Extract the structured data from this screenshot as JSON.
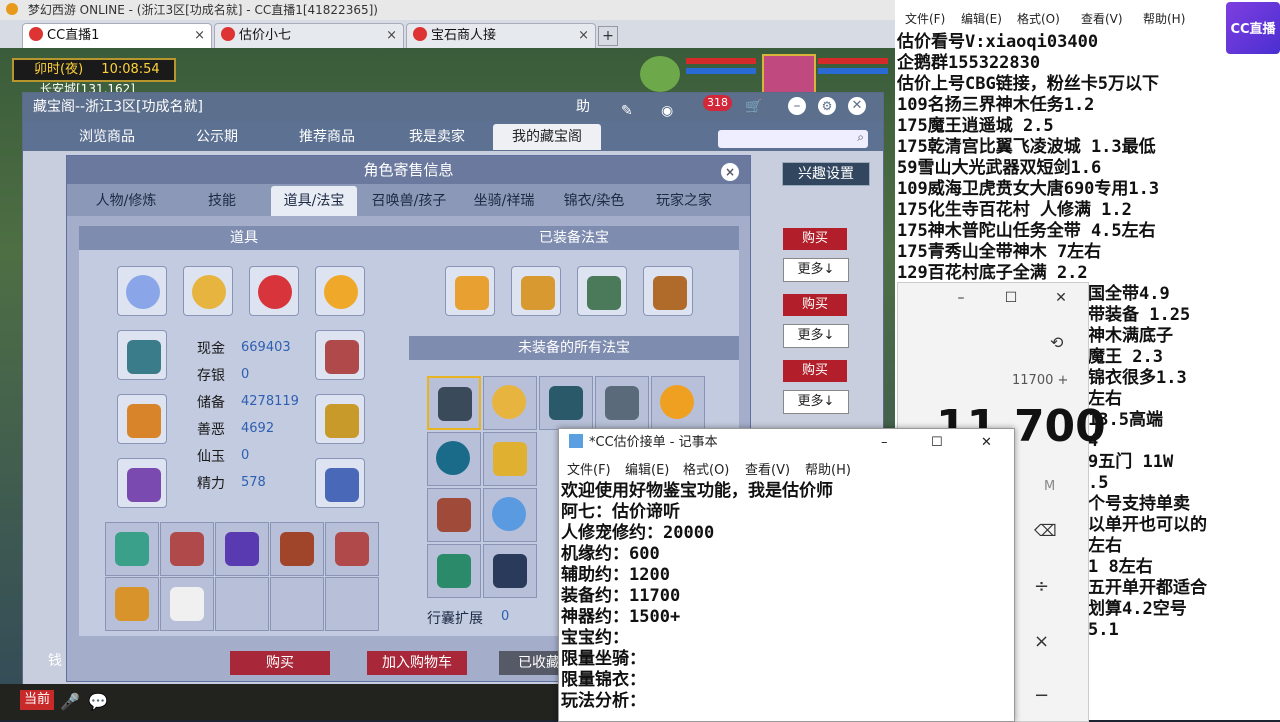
{
  "browser": {
    "title": "梦幻西游 ONLINE - (浙江3区[功成名就] - CC直播1[41822365])",
    "tabs": [
      {
        "label": "CC直播1",
        "active": true
      },
      {
        "label": "估价小七",
        "active": false
      },
      {
        "label": "宝石商人接",
        "active": false
      }
    ],
    "new_tab": "+"
  },
  "game": {
    "clock_label": "卯时(夜)",
    "clock_time": "10:08:54",
    "coords": "长安城[131,162]",
    "bottom_left": "当前",
    "bottom_money": "钱"
  },
  "cbg": {
    "title": "藏宝阁--浙江3区[功成名就]",
    "help": "助",
    "cart_count": "318",
    "nav": [
      "浏览商品",
      "公示期",
      "推荐商品",
      "我是卖家",
      "我的藏宝阁"
    ],
    "interest_btn": "兴趣设置",
    "side_buttons": [
      {
        "buy": "购买",
        "more": "更多↓"
      },
      {
        "buy": "购买",
        "more": "更多↓"
      },
      {
        "buy": "购买",
        "more": "更多↓"
      }
    ]
  },
  "dialog": {
    "title": "角色寄售信息",
    "close": "×",
    "tabs": [
      "人物/修炼",
      "技能",
      "道具/法宝",
      "召唤兽/孩子",
      "坐骑/祥瑞",
      "锦衣/染色",
      "玩家之家"
    ],
    "left_header": "道具",
    "right_header": "已装备法宝",
    "unequipped_header": "未装备的所有法宝",
    "stats": [
      {
        "label": "现金",
        "value": "669403"
      },
      {
        "label": "存银",
        "value": "0"
      },
      {
        "label": "储备",
        "value": "4278119"
      },
      {
        "label": "善恶",
        "value": "4692"
      },
      {
        "label": "仙玉",
        "value": "0"
      },
      {
        "label": "精力",
        "value": "578"
      }
    ],
    "bag_expand_label": "行囊扩展",
    "bag_expand_value": "0",
    "buttons": {
      "buy": "购买",
      "add_cart": "加入购物车",
      "collected": "已收藏"
    }
  },
  "notepad_big": {
    "menu": [
      "文件(F)",
      "编辑(E)",
      "格式(O)",
      "查看(V)",
      "帮助(H)"
    ],
    "lines": [
      "估价看号V:xiaoqi03400",
      "企鹅群155322830",
      "估价上号CBG链接，粉丝卡5万以下",
      "109名扬三界神木任务1.2",
      "175魔王逍遥城 2.5",
      "175乾清宫比翼飞凌波城 1.3最低",
      "59雪山大光武器双短剑1.6",
      "109威海卫虎贲女大唐690专用1.3",
      "175化生寺百花村 人修满 1.2",
      "175神木普陀山任务全带 4.5左右",
      "175青秀山全带神木  7左右",
      "129百花村底子全满 2.2"
    ],
    "partial_lines": [
      "国全带4.9",
      "带装备  1.25",
      "神木满底子",
      "魔王 2.3",
      "锦衣很多1.3",
      "左右",
      "13.5高端",
      "4",
      "9五门 11W",
      ".5",
      "个号支持单卖",
      "以单开也可以的",
      "左右",
      "1 8左右",
      "五开单开都适合",
      "划算4.2空号",
      "5.1"
    ]
  },
  "calculator": {
    "history": "11700 +",
    "display": "11,700",
    "memory": "M",
    "ops": [
      "⌫",
      "÷",
      "×",
      "−"
    ]
  },
  "notepad_small": {
    "title": "*CC估价接单 - 记事本",
    "menu": [
      "文件(F)",
      "编辑(E)",
      "格式(O)",
      "查看(V)",
      "帮助(H)"
    ],
    "lines": [
      "欢迎使用好物鉴宝功能，我是估价师",
      "阿七：估价谛听",
      "人修宠修约：20000",
      "机缘约：600",
      "辅助约：1200",
      "装备约：11700",
      "神器约：1500+",
      "宝宝约：",
      "限量坐骑：",
      "限量锦衣：",
      "玩法分析："
    ]
  },
  "logo": {
    "text": "CC直播"
  }
}
